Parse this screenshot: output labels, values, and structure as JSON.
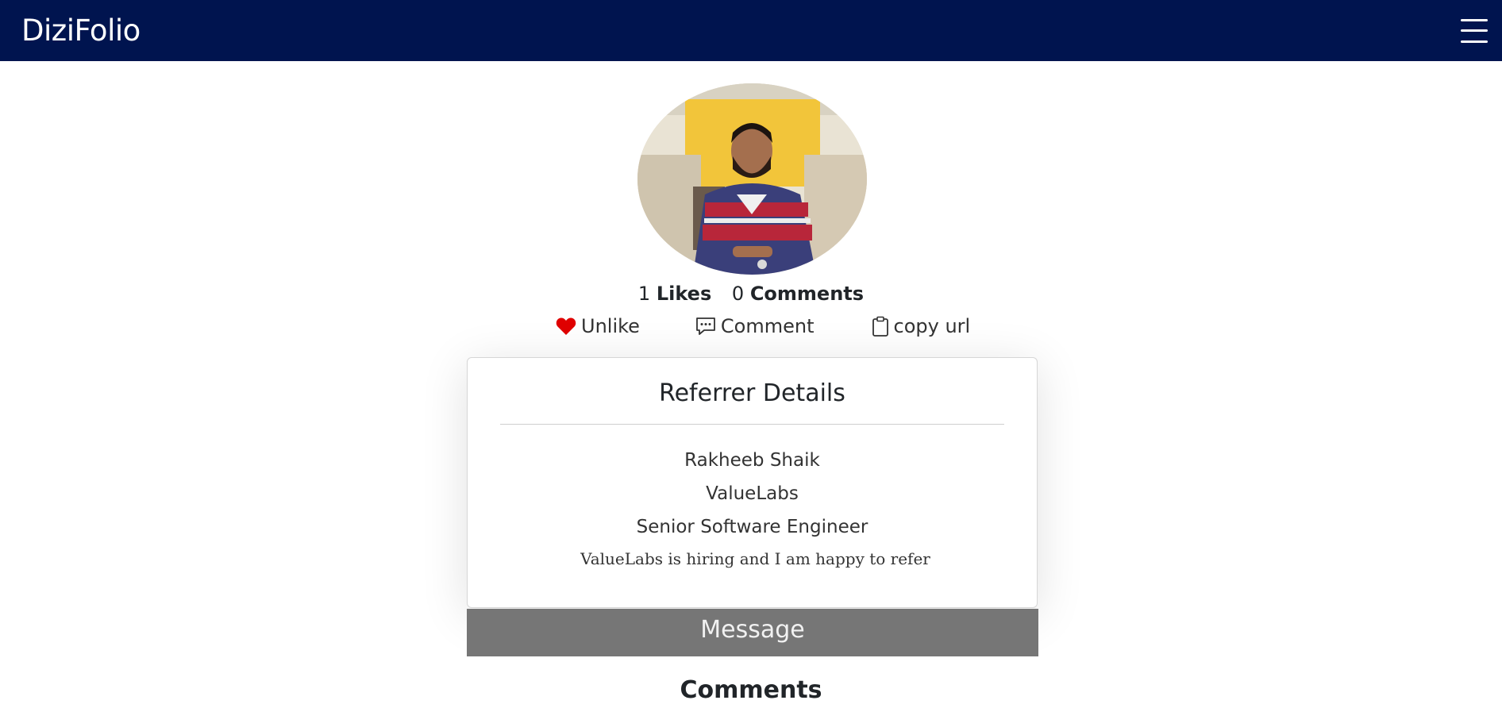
{
  "navbar": {
    "brand": "DiziFolio",
    "menu_icon": "hamburger-menu-icon"
  },
  "profile": {
    "avatar_alt": "profile photo"
  },
  "stats": {
    "likes_count": "1",
    "likes_label": "Likes",
    "comments_count": "0",
    "comments_label": "Comments"
  },
  "actions": {
    "unlike_label": "Unlike",
    "unlike_icon": "heart-filled-icon",
    "comment_label": "Comment",
    "comment_icon": "chat-dots-icon",
    "copy_label": "copy url",
    "copy_icon": "clipboard-icon"
  },
  "referrer": {
    "title": "Referrer Details",
    "name": "Rakheeb Shaik",
    "company": "ValueLabs",
    "role": "Senior Software Engineer",
    "note": "ValueLabs is hiring and I am happy to refer"
  },
  "message_button": "Message",
  "comments_heading": "Comments",
  "colors": {
    "navbar_bg": "#00144f",
    "heart": "#e00000",
    "message_bg": "#767676"
  }
}
